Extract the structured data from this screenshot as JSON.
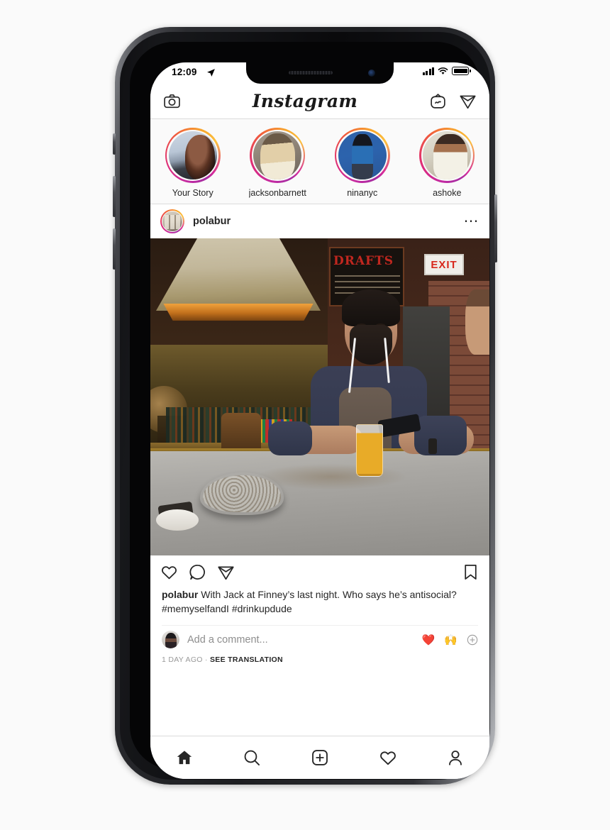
{
  "statusbar": {
    "time": "12:09",
    "location_icon": "location-arrow-icon",
    "signal_icon": "cellular-signal-icon",
    "wifi_icon": "wifi-icon",
    "battery_icon": "battery-full-icon"
  },
  "header": {
    "camera_icon": "camera-icon",
    "logo": "Instagram",
    "igtv_icon": "igtv-icon",
    "direct_icon": "paper-plane-icon"
  },
  "stories": [
    {
      "label": "Your Story",
      "avatar": "av1"
    },
    {
      "label": "jacksonbarnett",
      "avatar": "av2"
    },
    {
      "label": "ninanyc",
      "avatar": "av3"
    },
    {
      "label": "ashoke",
      "avatar": "av4"
    }
  ],
  "post": {
    "username": "polabur",
    "more_icon": "ellipsis-icon",
    "photo_alt": "Man with earbuds at a bar counter beside a model brain and a glass of beer",
    "actions": {
      "like_icon": "heart-icon",
      "comment_icon": "speech-bubble-icon",
      "share_icon": "paper-plane-icon",
      "save_icon": "bookmark-icon"
    },
    "caption": {
      "username": "polabur",
      "text": " With Jack at Finney’s last night. Who says he’s antisocial? #memyselfandI #drinkupdude"
    },
    "comment_placeholder": "Add a comment...",
    "quick_reactions": [
      "❤️",
      "🙌"
    ],
    "more_reactions_icon": "plus-circle-icon",
    "timestamp": "1 DAY AGO",
    "timestamp_separator": " · ",
    "translate_label": "SEE TRANSLATION"
  },
  "tabbar": [
    {
      "name": "home",
      "icon": "home-icon",
      "active": true
    },
    {
      "name": "search",
      "icon": "magnifier-icon",
      "active": false
    },
    {
      "name": "create",
      "icon": "plus-square-icon",
      "active": false
    },
    {
      "name": "activity",
      "icon": "heart-icon",
      "active": false
    },
    {
      "name": "profile",
      "icon": "person-icon",
      "active": false
    }
  ],
  "colors": {
    "accent_gradient_start": "#a32ca0",
    "accent_gradient_mid": "#dd2a7b",
    "accent_gradient_end": "#fcc03f",
    "text_primary": "#262626",
    "text_secondary": "#8e8e8e",
    "divider": "#dbdbdb",
    "heart_red": "#e0262a",
    "exit_red": "#d8281c"
  }
}
